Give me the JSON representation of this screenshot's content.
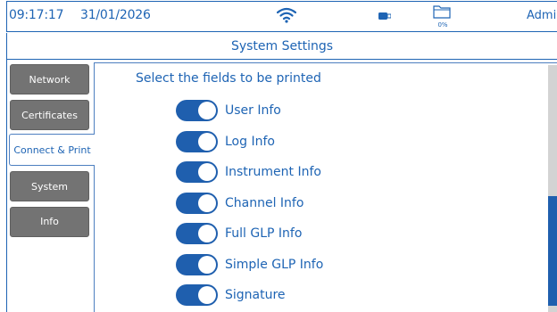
{
  "status_bar": {
    "time": "09:17:17",
    "date": "31/01/2026",
    "storage_percent": "0%",
    "user": "Admin",
    "icons": [
      "wifi-icon",
      "usb-icon",
      "folder-icon"
    ]
  },
  "title": "System Settings",
  "tabs": [
    {
      "label": "Network",
      "active": false
    },
    {
      "label": "Certificates",
      "active": false
    },
    {
      "label": "Connect & Print",
      "active": true
    },
    {
      "label": "System",
      "active": false
    },
    {
      "label": "Info",
      "active": false
    }
  ],
  "panel": {
    "heading": "Select the fields to be printed",
    "fields": [
      {
        "label": "User Info",
        "enabled": true
      },
      {
        "label": "Log Info",
        "enabled": true
      },
      {
        "label": "Instrument Info",
        "enabled": true
      },
      {
        "label": "Channel Info",
        "enabled": true
      },
      {
        "label": "Full GLP Info",
        "enabled": true
      },
      {
        "label": "Simple GLP Info",
        "enabled": true
      },
      {
        "label": "Signature",
        "enabled": true
      }
    ]
  },
  "scrollbar": {
    "position_fraction": 0.53
  },
  "colors": {
    "accent": "#1e64b4",
    "toggle_on": "#1f5fae",
    "tab_inactive": "#737373",
    "scroll_track": "#d3d3d3"
  }
}
